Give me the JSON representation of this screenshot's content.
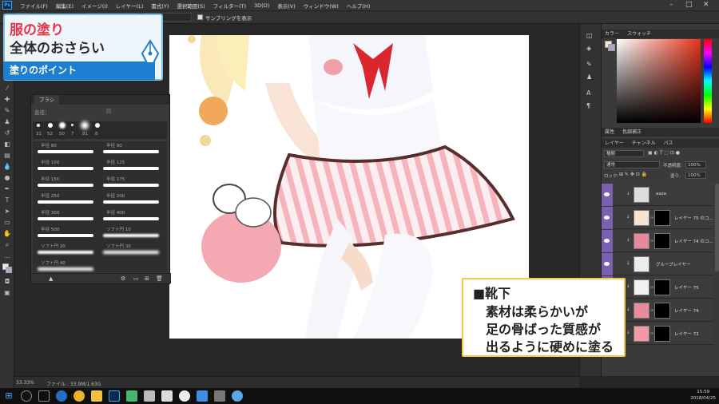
{
  "menubar": {
    "logo": "Ps",
    "items": [
      "ファイル(F)",
      "編集(E)",
      "イメージ(I)",
      "レイヤー(L)",
      "書式(Y)",
      "選択範囲(S)",
      "フィルター(T)",
      "3D(D)",
      "表示(V)",
      "ウィンドウ(W)",
      "ヘルプ(H)"
    ]
  },
  "optbar": {
    "sampling_label": "サンプリングを表示"
  },
  "title_card": {
    "line1": "服の塗り",
    "line2": "全体のおさらい",
    "subtitle": "塗りのポイント"
  },
  "brush_panel": {
    "tab": "ブラシ",
    "size_label": "直径：",
    "tips": [
      "31",
      "52",
      "50",
      "7",
      "81",
      "8"
    ],
    "brushes": [
      "半径 80",
      "半径 90",
      "半径 100",
      "半径 125",
      "半径 150",
      "半径 175",
      "半径 250",
      "半径 200",
      "半径 300",
      "半径 400",
      "半径 500",
      "ソフト円 10",
      "ソフト円 20",
      "ソフト円 30",
      "ソフト円 40",
      ""
    ]
  },
  "color_panel": {
    "tabs": [
      "カラー",
      "スウォッチ"
    ],
    "accent": "#e8331a"
  },
  "adjust_panel": {
    "tabs": [
      "属性",
      "色調補正"
    ]
  },
  "layers_panel": {
    "tabs": [
      "レイヤー",
      "チャンネル",
      "パス"
    ],
    "kind": "種類",
    "blend": "通常",
    "opacity_label": "不透明度:",
    "opacity": "100%",
    "lock_label": "ロック:",
    "fill_label": "塗り:",
    "fill": "100%",
    "layers": [
      {
        "name": "aaza",
        "thumb": "#dcdcdc",
        "mask": false
      },
      {
        "name": "レイヤー 75 のコ...",
        "thumb": "#f7e3d1",
        "mask": true
      },
      {
        "name": "レイヤー 74 のコ...",
        "thumb": "#e48a9a",
        "mask": true
      },
      {
        "name": "グループレイヤー",
        "thumb": "#ececec",
        "mask": false
      },
      {
        "name": "レイヤー 75",
        "thumb": "#f1f1f1",
        "mask": true
      },
      {
        "name": "レイヤー 74",
        "thumb": "#e58b9b",
        "mask": true
      },
      {
        "name": "レイヤー 73",
        "thumb": "#ef9aa5",
        "mask": true
      }
    ]
  },
  "callout": {
    "line1": "■靴下",
    "line2": "素材は柔らかいが",
    "line3": "足の骨ばった質感が",
    "line4": "出るように硬めに塗る"
  },
  "status": {
    "zoom": "33.33%",
    "file": "ファイル : 33.9M/1.63G"
  },
  "taskbar": {
    "time": "15:59",
    "date": "2018/04/25"
  }
}
